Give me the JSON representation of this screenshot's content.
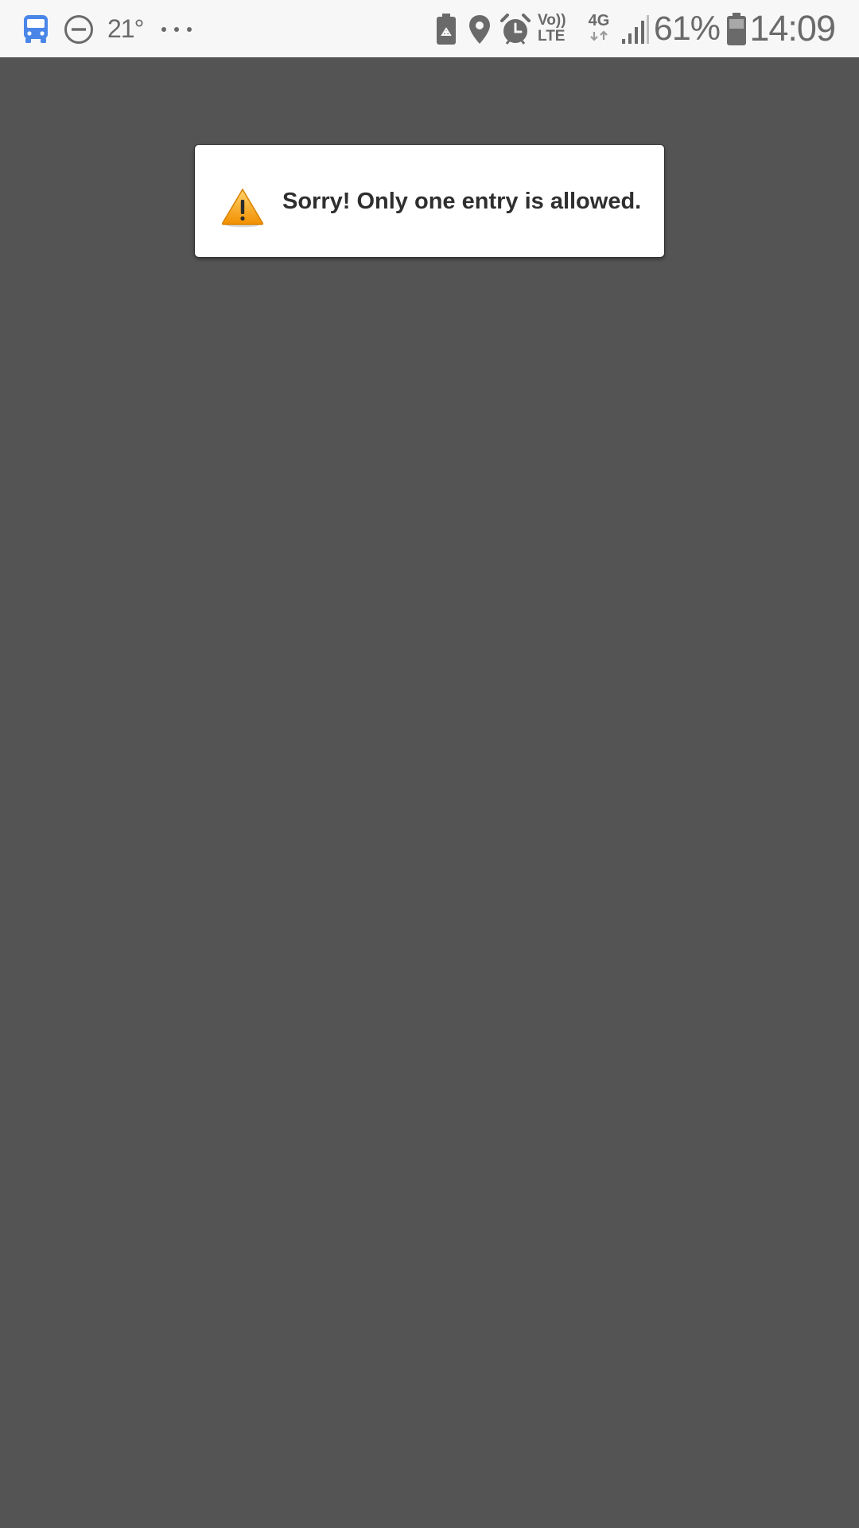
{
  "status_bar": {
    "temperature": "21°",
    "network_type": "4G",
    "volte_top": "Vo))",
    "volte_bottom": "LTE",
    "battery_percent": "61%",
    "time": "14:09",
    "icons": [
      "bus-icon",
      "do-not-disturb-icon",
      "more-dots-icon",
      "battery-saver-icon",
      "location-icon",
      "alarm-icon",
      "volte-icon",
      "4g-data-icon",
      "signal-icon",
      "battery-icon"
    ],
    "bus_icon_color": "#4a86e8"
  },
  "toast": {
    "message": "Sorry! Only one entry is allowed.",
    "icon": "warning-icon"
  },
  "colors": {
    "background": "#545454",
    "status_bar_bg": "#f7f7f7",
    "toast_bg": "#ffffff",
    "warning": "#f5a623"
  }
}
